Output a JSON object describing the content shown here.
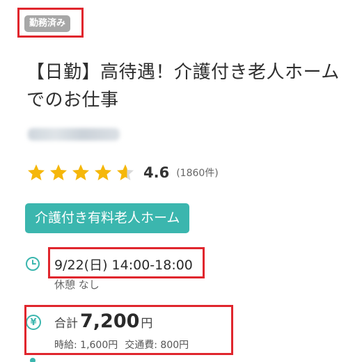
{
  "status_badge": "勤務済み",
  "job_title": "【日勤】高待遇！介護付き老人ホームでのお仕事",
  "rating": {
    "stars": 4.6,
    "score": "4.6",
    "count": "(1860件)"
  },
  "facility_type": "介護付き有料老人ホーム",
  "schedule": {
    "datetime": "9/22(日) 14:00-18:00",
    "break": "休憩 なし"
  },
  "pay": {
    "total_label": "合計",
    "total_amount": "7,200",
    "total_unit": "円",
    "hourly": "時給: 1,600円",
    "transport": "交通費: 800円"
  },
  "colors": {
    "accent": "#3bb6ae",
    "highlight": "#e0262d",
    "star": "#f5b70a",
    "badge": "#a7a7a7"
  },
  "icons": {
    "time": "clock-icon",
    "money": "yen-icon",
    "rating": "star-icon"
  }
}
